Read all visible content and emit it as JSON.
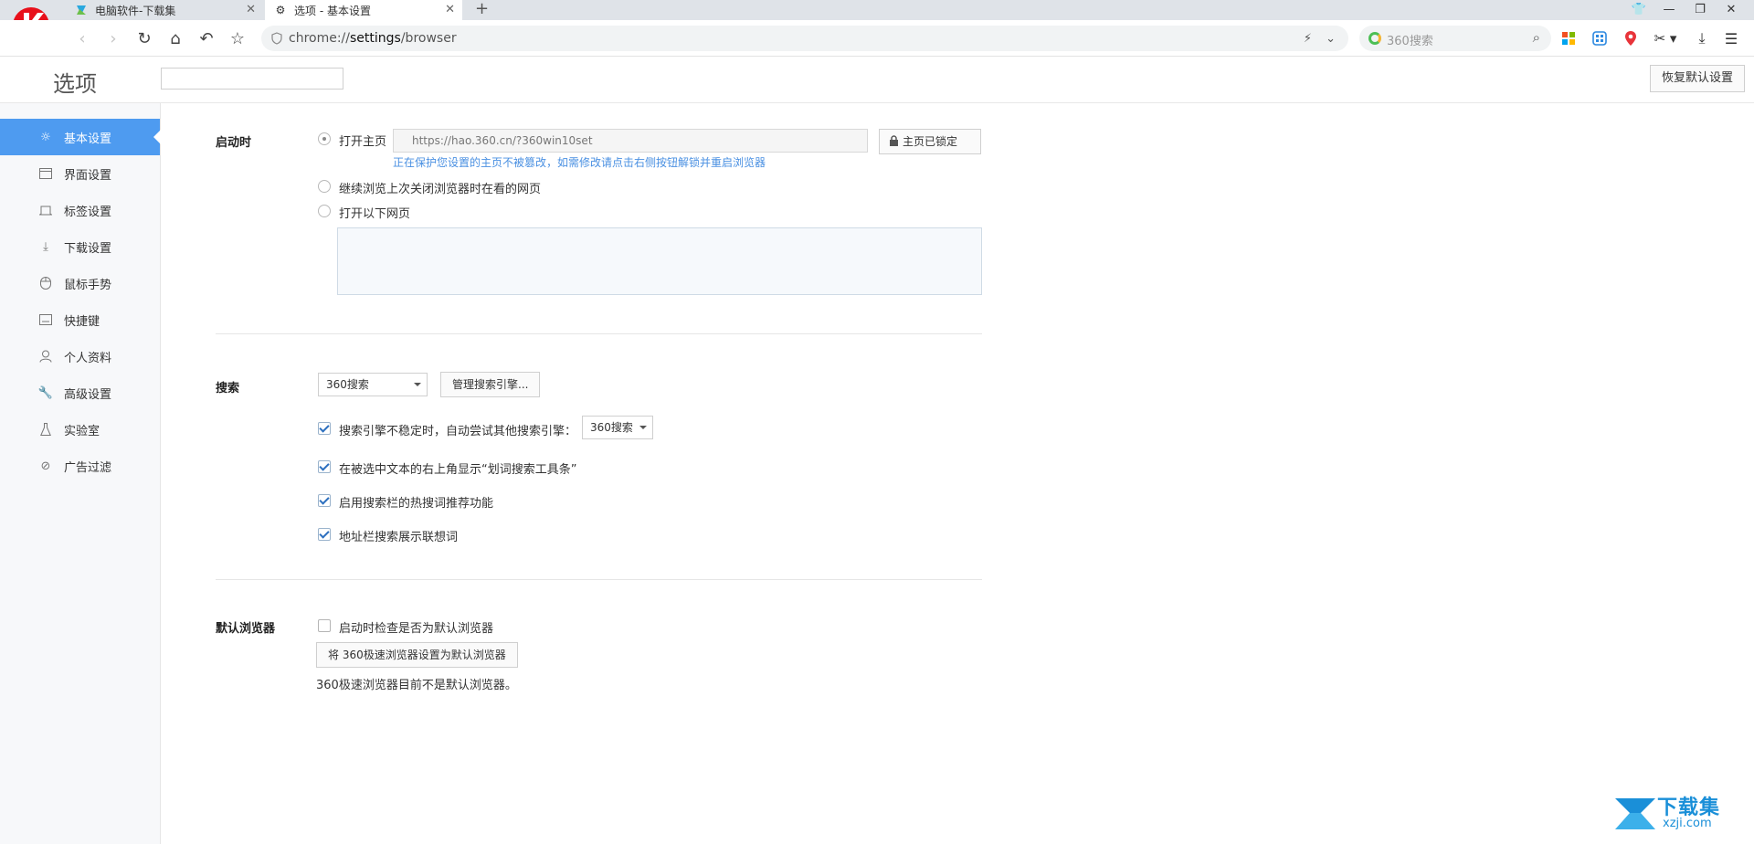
{
  "browser": {
    "tabs": [
      {
        "title": "电脑软件-下载集",
        "active": false
      },
      {
        "title": "选项 - 基本设置",
        "active": true
      }
    ],
    "address": {
      "prefix": "chrome://",
      "bold": "settings",
      "suffix": "/browser"
    },
    "search_placeholder": "360搜索"
  },
  "page": {
    "title": "选项",
    "search_value": "",
    "restore_label": "恢复默认设置"
  },
  "sidebar": {
    "items": [
      {
        "label": "基本设置",
        "icon": "gear-icon",
        "active": true
      },
      {
        "label": "界面设置",
        "icon": "window-icon",
        "active": false
      },
      {
        "label": "标签设置",
        "icon": "tab-icon",
        "active": false
      },
      {
        "label": "下载设置",
        "icon": "download-icon",
        "active": false
      },
      {
        "label": "鼠标手势",
        "icon": "mouse-icon",
        "active": false
      },
      {
        "label": "快捷键",
        "icon": "keyboard-icon",
        "active": false
      },
      {
        "label": "个人资料",
        "icon": "person-icon",
        "active": false
      },
      {
        "label": "高级设置",
        "icon": "wrench-icon",
        "active": false
      },
      {
        "label": "实验室",
        "icon": "flask-icon",
        "active": false
      },
      {
        "label": "广告过滤",
        "icon": "block-icon",
        "active": false
      }
    ]
  },
  "startup": {
    "label": "启动时",
    "option_home": "打开主页",
    "homepage_url": "https://hao.360.cn/?360win10set",
    "lock_label": "主页已锁定",
    "notice": "正在保护您设置的主页不被篡改，如需修改请点击右侧按钮解锁并重启浏览器",
    "option_continue": "继续浏览上次关闭浏览器时在看的网页",
    "option_pages": "打开以下网页"
  },
  "search": {
    "label": "搜索",
    "engine": "360搜索",
    "manage_label": "管理搜索引擎...",
    "fallback_label": "搜索引擎不稳定时，自动尝试其他搜索引擎：",
    "fallback_engine": "360搜索",
    "option_toolbar": "在被选中文本的右上角显示“划词搜索工具条”",
    "option_hot": "启用搜索栏的热搜词推荐功能",
    "option_suggest": "地址栏搜索展示联想词"
  },
  "default_browser": {
    "label": "默认浏览器",
    "check_label": "启动时检查是否为默认浏览器",
    "set_button": "将 360极速浏览器设置为默认浏览器",
    "status": "360极速浏览器目前不是默认浏览器。"
  },
  "watermark": {
    "brand": "下载集",
    "site": "xzji.com"
  },
  "colors": {
    "accent": "#4e9bf0",
    "link": "#4a90e2",
    "watermark": "#1a8fd8"
  }
}
